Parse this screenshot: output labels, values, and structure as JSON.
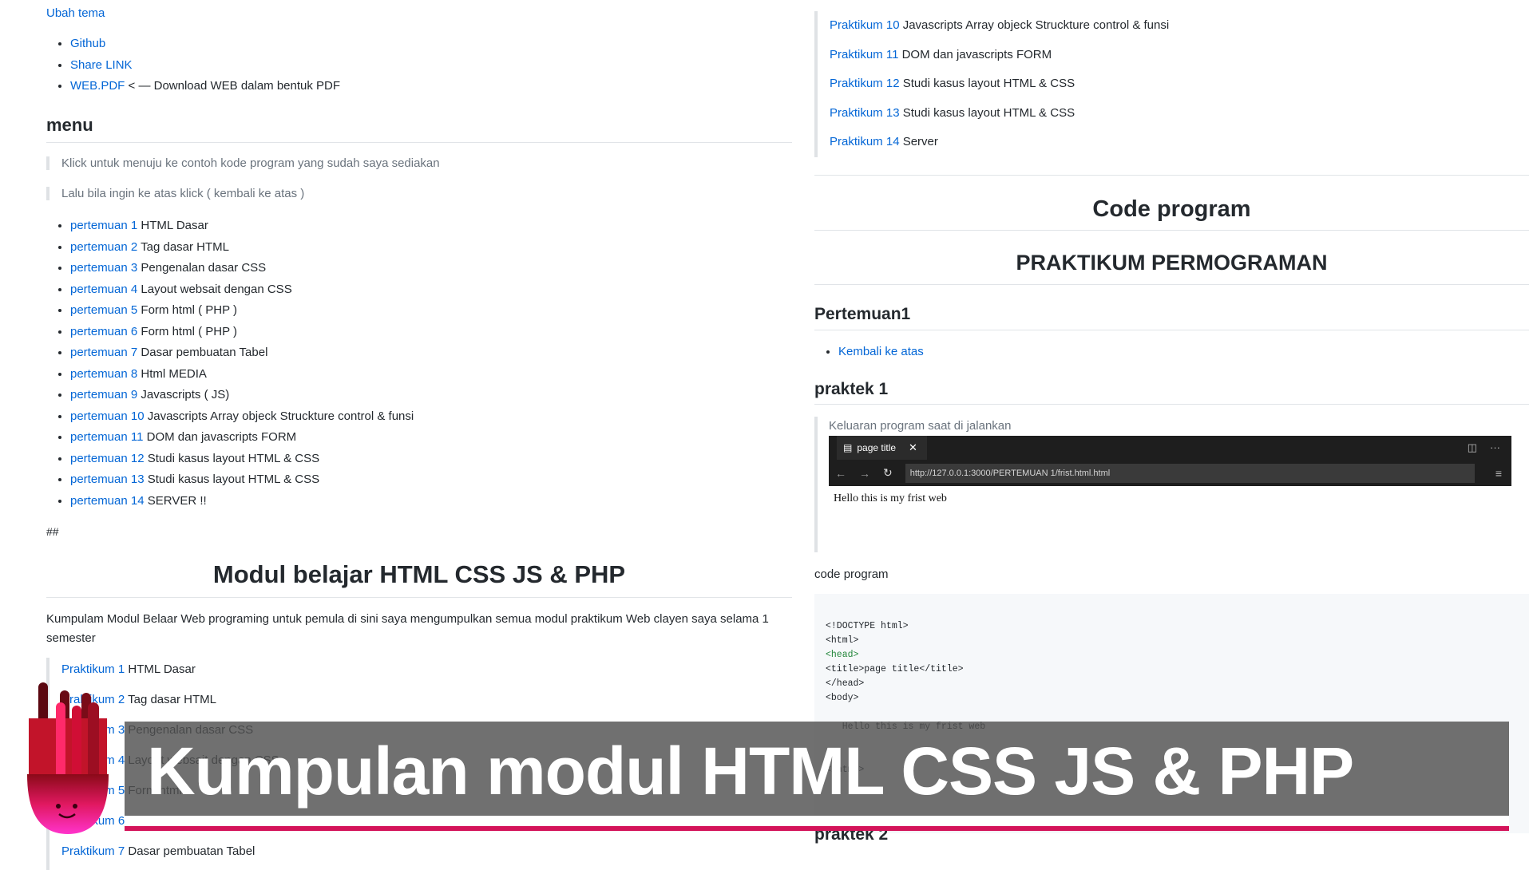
{
  "left": {
    "ubah_tema": "Ubah tema",
    "links": [
      {
        "link": "Github",
        "text": ""
      },
      {
        "link": "Share LINK",
        "text": ""
      },
      {
        "link": "WEB.PDF",
        "text": " < — Download WEB dalam bentuk PDF"
      }
    ],
    "menu_heading": "menu",
    "quote1": "Klick untuk menuju ke contoh kode program yang sudah saya sediakan",
    "quote2": "Lalu bila ingin ke atas klick ( kembali ke atas )",
    "pertemuan": [
      {
        "link": "pertemuan 1",
        "text": " HTML Dasar"
      },
      {
        "link": "pertemuan 2",
        "text": " Tag dasar HTML"
      },
      {
        "link": "pertemuan 3",
        "text": " Pengenalan dasar CSS"
      },
      {
        "link": "pertemuan 4",
        "text": " Layout websait dengan CSS"
      },
      {
        "link": "pertemuan 5",
        "text": " Form html ( PHP )"
      },
      {
        "link": "pertemuan 6",
        "text": " Form html ( PHP )"
      },
      {
        "link": "pertemuan 7",
        "text": " Dasar pembuatan Tabel"
      },
      {
        "link": "pertemuan 8",
        "text": " Html MEDIA"
      },
      {
        "link": "pertemuan 9",
        "text": " Javascripts ( JS)"
      },
      {
        "link": "pertemuan 10",
        "text": " Javascripts Array objeck Struckture control & funsi"
      },
      {
        "link": "pertemuan 11",
        "text": " DOM dan javascripts FORM"
      },
      {
        "link": "pertemuan 12",
        "text": " Studi kasus layout HTML & CSS"
      },
      {
        "link": "pertemuan 13",
        "text": " Studi kasus layout HTML & CSS"
      },
      {
        "link": "pertemuan 14",
        "text": " SERVER !!"
      }
    ],
    "hashes": "##",
    "modul_title": "Modul belajar HTML CSS JS & PHP",
    "modul_para": "Kumpulam Modul Belaar Web programing untuk pemula di sini saya mengumpulkan semua modul praktikum Web clayen saya selama 1 semester",
    "praktikum": [
      {
        "link": "Praktikum 1",
        "text": " HTML Dasar"
      },
      {
        "link": "Praktikum 2",
        "text": " Tag dasar HTML"
      },
      {
        "link": "Praktikum 3",
        "text": " Pengenalan dasar CSS"
      },
      {
        "link": "Praktikum 4",
        "text": " Layout websait dengan CSS"
      },
      {
        "link": "Praktikum 5",
        "text": " Form html"
      },
      {
        "link": "Praktikum 6",
        "text": ""
      },
      {
        "link": "Praktikum 7",
        "text": " Dasar pembuatan Tabel"
      }
    ]
  },
  "right": {
    "praktikum": [
      {
        "link": "Praktikum 10",
        "text": " Javascripts Array objeck Struckture control & funsi"
      },
      {
        "link": "Praktikum 11",
        "text": " DOM dan javascripts FORM"
      },
      {
        "link": "Praktikum 12",
        "text": " Studi kasus layout HTML & CSS"
      },
      {
        "link": "Praktikum 13",
        "text": " Studi kasus layout HTML & CSS"
      },
      {
        "link": "Praktikum 14",
        "text": " Server"
      }
    ],
    "code_program_title": "Code program",
    "praktikum_title": "PRAKTIKUM PERMOGRAMAN",
    "pertemuan1_heading": "Pertemuan1",
    "kembali_link": "Kembali ke atas",
    "praktek1_heading": "praktek 1",
    "output_label": "Keluaran program saat di jalankan",
    "browser": {
      "tab_title": "page title",
      "url": "http://127.0.0.1:3000/PERTEMUAN 1/frist.html.html",
      "page_text": "Hello this is my frist web"
    },
    "code_label": "code program",
    "code_lines": [
      "<!DOCTYPE html>",
      "<html>",
      "<head>",
      "<title>page title</title>",
      "</head>",
      "<body>",
      "",
      "   Hello this is my frist web",
      "",
      "",
      "</html>"
    ],
    "praktek2_heading": "praktek 2"
  },
  "banner": {
    "title": "Kumpulan modul HTML CSS JS & PHP",
    "accent_color": "#d4145a"
  }
}
